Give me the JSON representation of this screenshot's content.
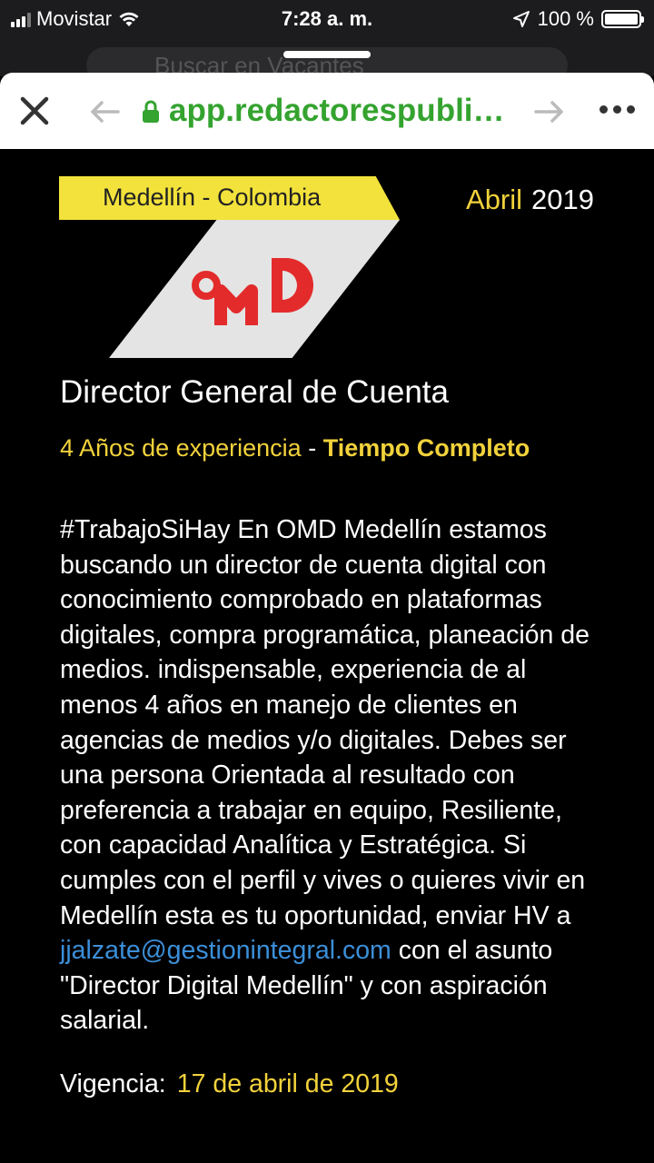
{
  "status_bar": {
    "carrier": "Movistar",
    "time": "7:28 a. m.",
    "battery": "100 %"
  },
  "browser": {
    "behind_search_placeholder": "Buscar en Vacantes",
    "url": "app.redactorespublicitarios.com",
    "secure": true,
    "url_color": "#34a32f"
  },
  "job": {
    "location": "Medellín - Colombia",
    "month": "Abril",
    "year": "2019",
    "company_logo": "OMD",
    "title": "Director General de Cuenta",
    "experience": "4 Años de experiencia",
    "separator": " - ",
    "job_type": "Tiempo Completo",
    "description_before_email": "#TrabajoSiHay En OMD Medellín estamos buscando un director de cuenta digital con conocimiento comprobado en plataformas digitales, compra programática, planeación de medios. indispensable, experiencia de al menos 4 años en manejo de clientes en agencias de medios y/o digitales. Debes ser una persona Orientada al resultado con preferencia a trabajar en equipo, Resiliente, con capacidad Analítica y Estratégica. Si cumples con el perfil y vives o quieres vivir en Medellín esta es tu oportunidad, enviar HV a ",
    "email": "jjalzate@gestionintegral.com",
    "description_after_email": " con el asunto \"Director Digital Medellín\" y con aspiración salarial.",
    "validity_label": "Vigencia:",
    "validity_date": "17 de abril de 2019"
  },
  "colors": {
    "accent_yellow": "#f2d23b",
    "banner_yellow": "#f2e23b",
    "logo_red": "#e32b2b",
    "link_blue": "#3b8fd8",
    "background": "#000000"
  }
}
